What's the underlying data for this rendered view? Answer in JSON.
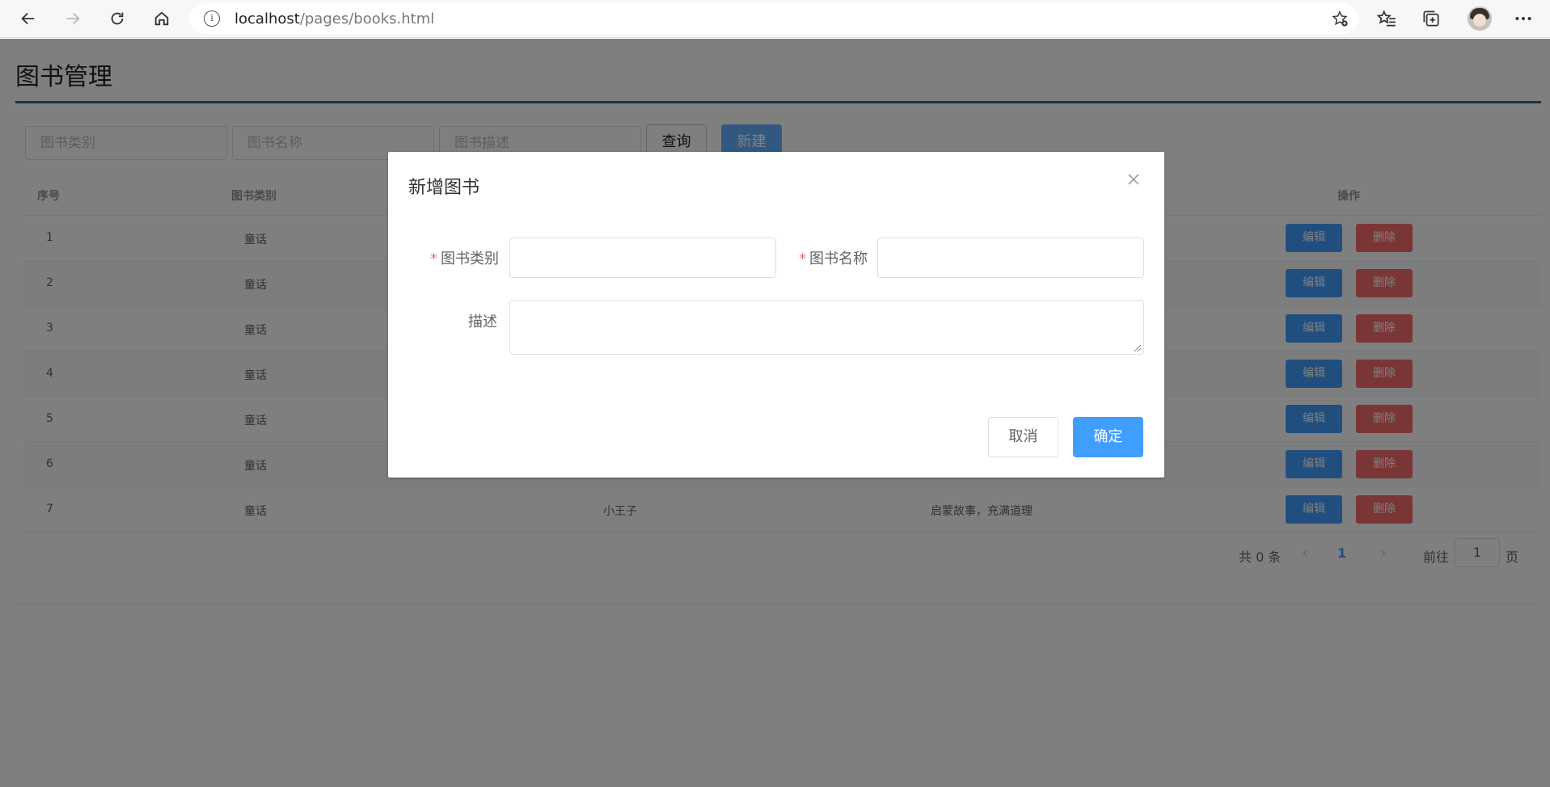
{
  "browser": {
    "url_host": "localhost",
    "url_path": "/pages/books.html",
    "info_glyph": "i"
  },
  "page": {
    "title": "图书管理",
    "filters": {
      "category_placeholder": "图书类别",
      "name_placeholder": "图书名称",
      "desc_placeholder": "图书描述",
      "query_label": "查询",
      "new_label": "新建"
    },
    "table": {
      "headers": {
        "index": "序号",
        "category": "图书类别",
        "actions": "操作"
      },
      "rows": [
        {
          "index": "1",
          "category": "童话",
          "name": "",
          "desc": ""
        },
        {
          "index": "2",
          "category": "童话",
          "name": "",
          "desc": ""
        },
        {
          "index": "3",
          "category": "童话",
          "name": "",
          "desc": ""
        },
        {
          "index": "4",
          "category": "童话",
          "name": "",
          "desc": ""
        },
        {
          "index": "5",
          "category": "童话",
          "name": "",
          "desc": ""
        },
        {
          "index": "6",
          "category": "童话",
          "name": "",
          "desc": ""
        },
        {
          "index": "7",
          "category": "童话",
          "name": "小王子",
          "desc": "启蒙故事，充满道理"
        }
      ],
      "edit_label": "编辑",
      "delete_label": "删除"
    },
    "pagination": {
      "total": "共 0 条",
      "prev": "‹",
      "current_page": "1",
      "next": "›",
      "goto_label": "前往",
      "goto_value": "1",
      "page_unit": "页"
    }
  },
  "dialog": {
    "title": "新增图书",
    "close_glyph": "×",
    "category_label": "图书类别",
    "name_label": "图书名称",
    "desc_label": "描述",
    "required_mark": "*",
    "cancel_label": "取消",
    "confirm_label": "确定"
  }
}
